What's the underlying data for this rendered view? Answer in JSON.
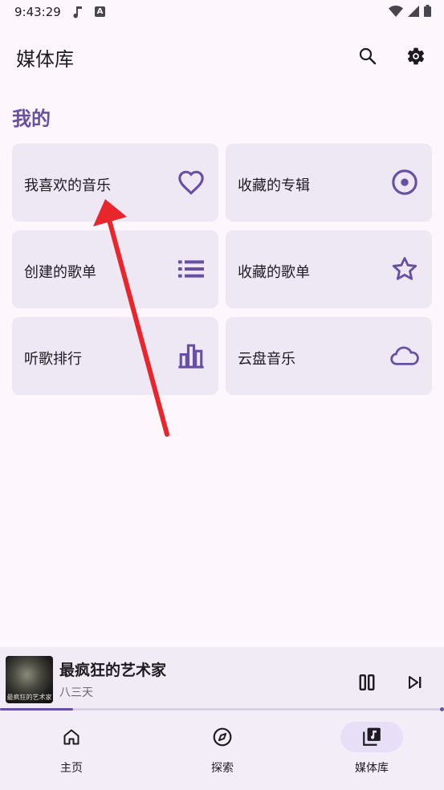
{
  "status_bar": {
    "time": "9:43:29",
    "a_badge": "A"
  },
  "app_bar": {
    "title": "媒体库"
  },
  "section": {
    "title": "我的"
  },
  "tiles": [
    {
      "label": "我喜欢的音乐",
      "icon": "heart-icon"
    },
    {
      "label": "收藏的专辑",
      "icon": "album-disc-icon"
    },
    {
      "label": "创建的歌单",
      "icon": "list-icon"
    },
    {
      "label": "收藏的歌单",
      "icon": "star-icon"
    },
    {
      "label": "听歌排行",
      "icon": "bar-chart-icon"
    },
    {
      "label": "云盘音乐",
      "icon": "cloud-icon"
    }
  ],
  "mini_player": {
    "title": "最疯狂的艺术家",
    "artist": "八三天",
    "cover_text": "最疯狂的艺术家",
    "progress": 0.165
  },
  "bottom_nav": [
    {
      "label": "主页",
      "icon": "home-icon",
      "active": false
    },
    {
      "label": "探索",
      "icon": "compass-icon",
      "active": false
    },
    {
      "label": "媒体库",
      "icon": "library-music-icon",
      "active": true
    }
  ],
  "colors": {
    "accent": "#6750a4",
    "tile_bg": "#eee7f4",
    "annotation_arrow": "#e8262b"
  }
}
